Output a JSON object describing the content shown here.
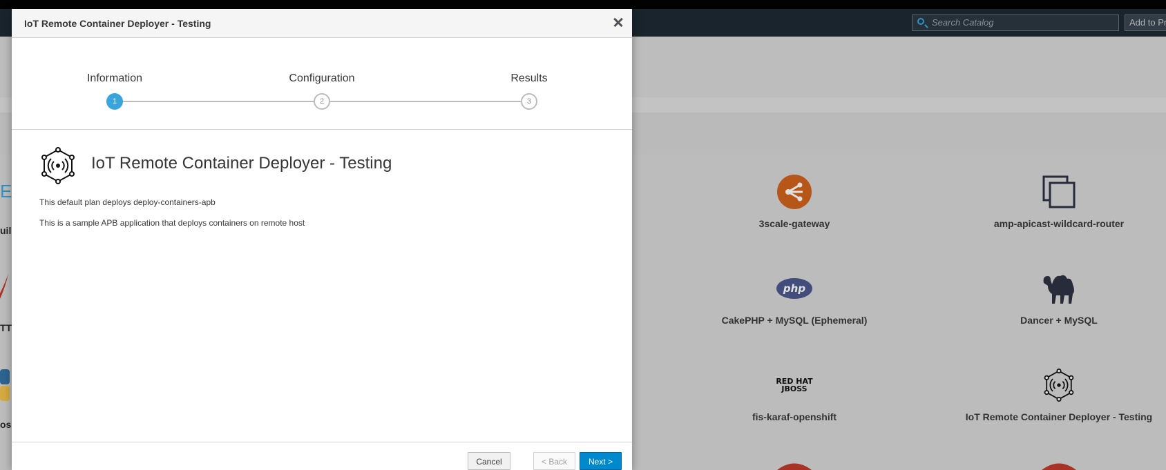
{
  "background": {
    "search": {
      "placeholder": "Search Catalog"
    },
    "add_to_project": "Add to Project",
    "partial_texts": [
      "ET",
      "uil",
      "TTF",
      "os"
    ],
    "catalog_tiles": [
      {
        "name": "3scale-gateway",
        "icon": "3scale-icon"
      },
      {
        "name": "amp-apicast-wildcard-router",
        "icon": "copy-icon"
      },
      {
        "name": "CakePHP + MySQL (Ephemeral)",
        "icon": "php-icon",
        "icon_text": "php"
      },
      {
        "name": "Dancer + MySQL",
        "icon": "camel-icon"
      },
      {
        "name": "fis-karaf-openshift",
        "icon": "redhat-jboss-icon",
        "icon_text_line1": "RED HAT",
        "icon_text_line2": "JBOSS"
      },
      {
        "name": "IoT Remote Container Deployer - Testing",
        "icon": "iot-icon"
      }
    ]
  },
  "modal": {
    "title": "IoT Remote Container Deployer - Testing",
    "steps": [
      {
        "label": "Information",
        "number": "1",
        "active": true
      },
      {
        "label": "Configuration",
        "number": "2",
        "active": false
      },
      {
        "label": "Results",
        "number": "3",
        "active": false
      }
    ],
    "heading": "IoT Remote Container Deployer - Testing",
    "plan_description": "This default plan deploys deploy-containers-apb",
    "app_description": "This is a sample APB application that deploys containers on remote host",
    "buttons": {
      "cancel": "Cancel",
      "back": "< Back",
      "next": "Next >"
    }
  },
  "colors": {
    "accent": "#39a5dc",
    "primary_button": "#0088ce",
    "navbar": "#1d2a33",
    "orange_icon": "#d0631d",
    "dark_icon": "#2d3242"
  }
}
